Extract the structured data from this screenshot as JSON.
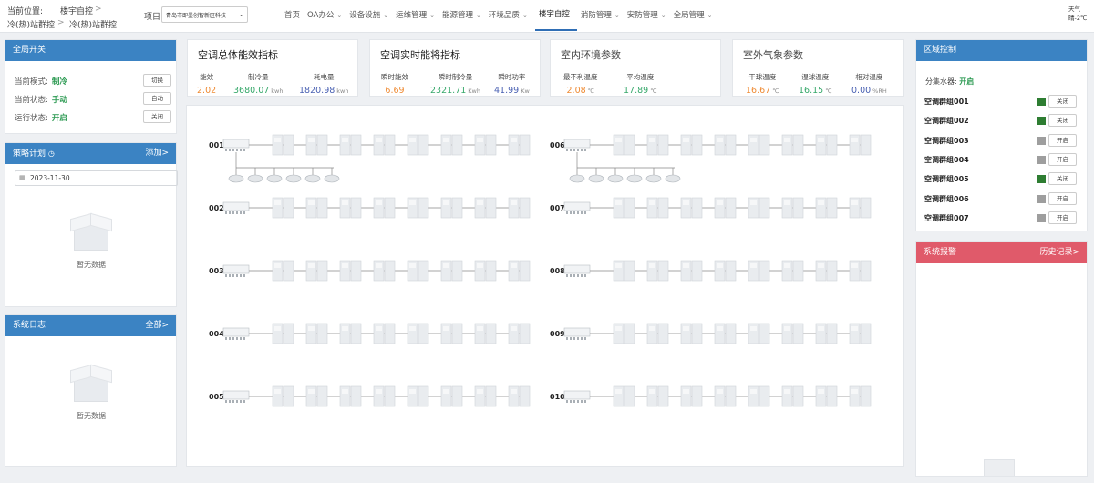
{
  "breadcrumb": {
    "label": "当前位置:",
    "item1": "楼宇自控",
    "item2": "冷(热)站群控",
    "item3": "冷(热)站群控",
    "sep": ">"
  },
  "project": {
    "label": "项目:",
    "value": "青岛市即墨创智新区科技"
  },
  "nav": [
    {
      "label": "首页",
      "arrow": false,
      "active": false
    },
    {
      "label": "OA办公",
      "arrow": true,
      "active": false
    },
    {
      "label": "设备设施",
      "arrow": true,
      "active": false
    },
    {
      "label": "运维管理",
      "arrow": true,
      "active": false
    },
    {
      "label": "能源管理",
      "arrow": true,
      "active": false
    },
    {
      "label": "环境品质",
      "arrow": true,
      "active": false
    },
    {
      "label": "楼宇自控",
      "arrow": false,
      "active": true
    },
    {
      "label": "消防管理",
      "arrow": true,
      "active": false
    },
    {
      "label": "安防管理",
      "arrow": true,
      "active": false
    },
    {
      "label": "全局管理",
      "arrow": true,
      "active": false
    }
  ],
  "weather": {
    "label": "天气",
    "value": "晴-2℃"
  },
  "global_switch": {
    "title": "全局开关",
    "mode_label": "当前模式:",
    "mode_value": "制冷",
    "mode_btn": "切换",
    "state_label": "当前状态:",
    "state_value": "手动",
    "state_btn": "自动",
    "run_label": "运行状态:",
    "run_value": "开启",
    "run_btn": "关闭"
  },
  "strategy": {
    "title": "策略计划",
    "add": "添加>",
    "date": "2023-11-30",
    "empty": "暂无数据"
  },
  "syslog": {
    "title": "系统日志",
    "all": "全部>",
    "empty": "暂无数据"
  },
  "kpi1": {
    "title": "空调总体能效指标",
    "items": [
      {
        "label": "能效",
        "value": "2.02",
        "unit": ""
      },
      {
        "label": "制冷量",
        "value": "3680.07",
        "unit": "kwh"
      },
      {
        "label": "耗电量",
        "value": "1820.98",
        "unit": "kwh"
      }
    ]
  },
  "kpi2": {
    "title": "空调实时能将指标",
    "items": [
      {
        "label": "瞬时能效",
        "value": "6.69",
        "unit": ""
      },
      {
        "label": "瞬时制冷量",
        "value": "2321.71",
        "unit": "Kwh"
      },
      {
        "label": "瞬时功率",
        "value": "41.99",
        "unit": "Kw"
      }
    ]
  },
  "kpi3": {
    "title": "室内环境参数",
    "items": [
      {
        "label": "最不利温度",
        "value": "2.08",
        "unit": "℃"
      },
      {
        "label": "平均温度",
        "value": "17.89",
        "unit": "℃"
      }
    ]
  },
  "kpi4": {
    "title": "室外气象参数",
    "items": [
      {
        "label": "干球温度",
        "value": "16.67",
        "unit": "℃"
      },
      {
        "label": "湿球温度",
        "value": "16.15",
        "unit": "℃"
      },
      {
        "label": "相对温度",
        "value": "0.00",
        "unit": "%RH"
      }
    ]
  },
  "groups": [
    "001",
    "002",
    "003",
    "004",
    "005",
    "006",
    "007",
    "008",
    "009",
    "010"
  ],
  "zone": {
    "title": "区域控制",
    "collector_label": "分集水器:",
    "collector_value": "开启",
    "items": [
      {
        "name": "空调群组001",
        "status_color": "#2e7d32",
        "btn": "关闭"
      },
      {
        "name": "空调群组002",
        "status_color": "#2e7d32",
        "btn": "关闭"
      },
      {
        "name": "空调群组003",
        "status_color": "#9e9e9e",
        "btn": "开启"
      },
      {
        "name": "空调群组004",
        "status_color": "#9e9e9e",
        "btn": "开启"
      },
      {
        "name": "空调群组005",
        "status_color": "#2e7d32",
        "btn": "关闭"
      },
      {
        "name": "空调群组006",
        "status_color": "#9e9e9e",
        "btn": "开启"
      },
      {
        "name": "空调群组007",
        "status_color": "#9e9e9e",
        "btn": "开启"
      }
    ]
  },
  "alarm": {
    "title": "系统报警",
    "history": "历史记录>"
  }
}
